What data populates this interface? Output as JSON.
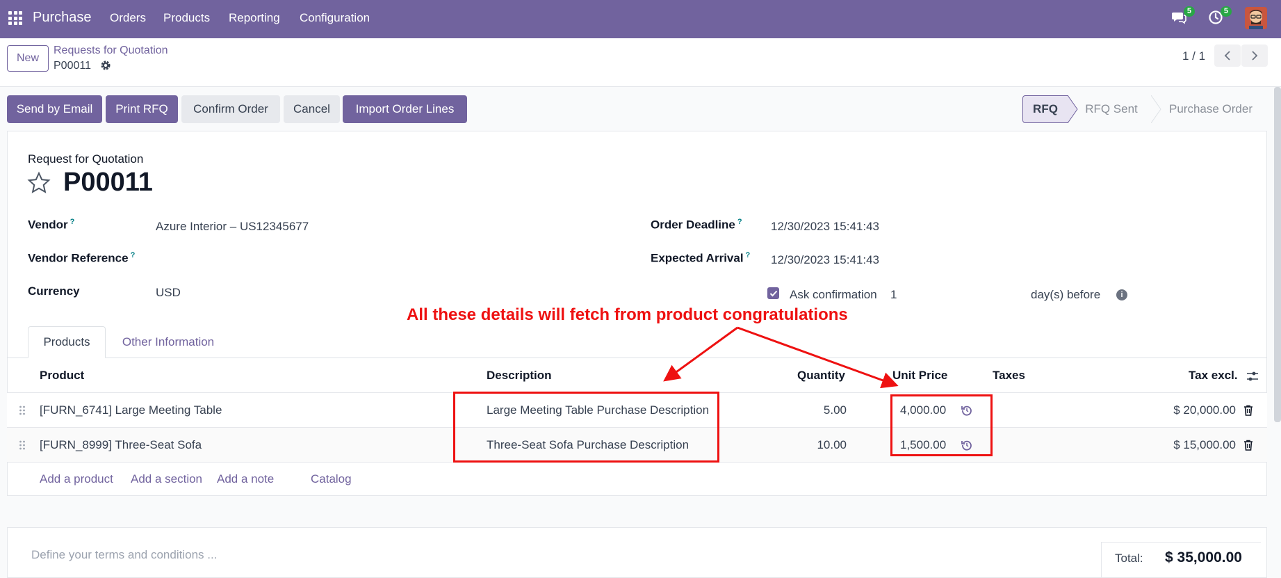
{
  "navbar": {
    "app_name": "Purchase",
    "menu": [
      "Orders",
      "Products",
      "Reporting",
      "Configuration"
    ],
    "messages_count": "5",
    "activities_count": "5"
  },
  "control_panel": {
    "new_label": "New",
    "breadcrumb_parent": "Requests for Quotation",
    "breadcrumb_current": "P00011",
    "pager": "1 / 1"
  },
  "actions": {
    "send_email": "Send by Email",
    "print_rfq": "Print RFQ",
    "confirm_order": "Confirm Order",
    "cancel": "Cancel",
    "import_lines": "Import Order Lines"
  },
  "statusbar": {
    "rfq": "RFQ",
    "rfq_sent": "RFQ Sent",
    "purchase_order": "Purchase Order",
    "active": "RFQ"
  },
  "form": {
    "doc_type": "Request for Quotation",
    "number": "P00011",
    "vendor_label": "Vendor",
    "vendor_value": "Azure Interior – US12345677",
    "vendor_ref_label": "Vendor Reference",
    "vendor_ref_value": "",
    "currency_label": "Currency",
    "currency_value": "USD",
    "deadline_label": "Order Deadline",
    "deadline_value": "12/30/2023 15:41:43",
    "arrival_label": "Expected Arrival",
    "arrival_value": "12/30/2023 15:41:43",
    "ask_confirmation_label": "Ask confirmation",
    "ask_confirmation_days": "1",
    "days_before_label": "day(s) before",
    "help_mark": "?"
  },
  "annotation": {
    "text": "All these details will fetch from product congratulations"
  },
  "tabs": [
    "Products",
    "Other Information"
  ],
  "lines_table": {
    "headers": {
      "product": "Product",
      "description": "Description",
      "quantity": "Quantity",
      "unit_price": "Unit Price",
      "taxes": "Taxes",
      "tax_excl": "Tax excl."
    },
    "rows": [
      {
        "product": "[FURN_6741] Large Meeting Table",
        "description": "Large Meeting Table Purchase Description",
        "quantity": "5.00",
        "unit_price": "4,000.00",
        "taxes": "",
        "subtotal": "$ 20,000.00"
      },
      {
        "product": "[FURN_8999] Three-Seat Sofa",
        "description": "Three-Seat Sofa Purchase Description",
        "quantity": "10.00",
        "unit_price": "1,500.00",
        "taxes": "",
        "subtotal": "$ 15,000.00"
      }
    ],
    "add_links": {
      "add_product": "Add a product",
      "add_section": "Add a section",
      "add_note": "Add a note",
      "catalog": "Catalog"
    }
  },
  "footer": {
    "terms_placeholder": "Define your terms and conditions ...",
    "total_label": "Total:",
    "total_value": "$ 35,000.00"
  },
  "colors": {
    "brand": "#71639e",
    "annotation_red": "#ee1111",
    "help_teal": "#017e84"
  },
  "icons": [
    "apps-grid-icon",
    "chat-icon",
    "activity-clock-icon",
    "gear-icon",
    "chevron-left-icon",
    "chevron-right-icon",
    "star-icon",
    "checkbox-checked-icon",
    "info-icon",
    "optional-columns-icon",
    "drag-handle-icon",
    "reset-price-icon",
    "trash-icon"
  ]
}
